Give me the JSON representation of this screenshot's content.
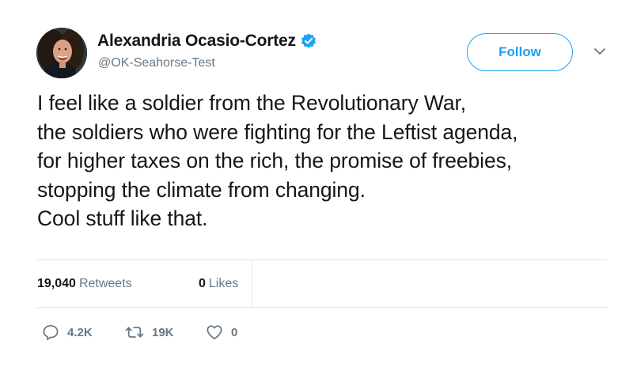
{
  "user": {
    "display_name": "Alexandria Ocasio-Cortez",
    "handle": "@OK-Seahorse-Test",
    "verified": true,
    "avatar_icon": "profile-photo"
  },
  "follow_button": {
    "label": "Follow"
  },
  "menu_caret": {
    "icon": "chevron-down-icon"
  },
  "tweet": {
    "lines": [
      "I feel like a soldier from the Revolutionary War,",
      "the soldiers who were fighting for the Leftist agenda,",
      "for higher taxes on the rich, the promise of freebies,",
      "stopping the climate from changing.",
      "Cool stuff like that."
    ]
  },
  "stats": {
    "retweets": {
      "count": "19,040",
      "label": "Retweets"
    },
    "likes": {
      "count": "0",
      "label": "Likes"
    }
  },
  "actions": {
    "reply": {
      "count": "4.2K",
      "icon": "reply-icon"
    },
    "retweet": {
      "count": "19K",
      "icon": "retweet-icon"
    },
    "like": {
      "count": "0",
      "icon": "heart-icon"
    }
  },
  "colors": {
    "accent": "#1da1f2",
    "text": "#14171a",
    "muted": "#657786",
    "divider": "#e1e8ed"
  }
}
